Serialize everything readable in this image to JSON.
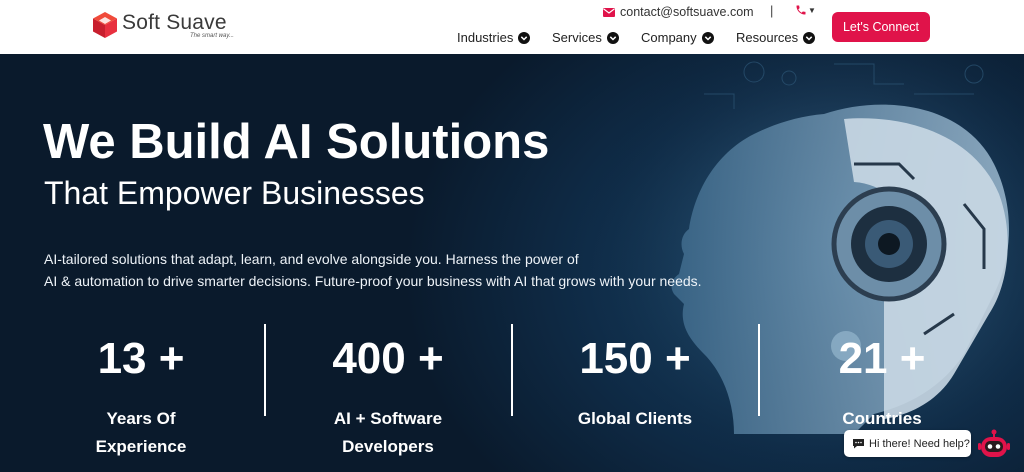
{
  "brand": {
    "name": "Soft Suave",
    "tagline": "The smart way...",
    "accent": "#e0134a"
  },
  "header": {
    "email": "contact@softsuave.com",
    "separator": "|",
    "nav": [
      {
        "label": "Industries"
      },
      {
        "label": "Services"
      },
      {
        "label": "Company"
      },
      {
        "label": "Resources"
      }
    ],
    "cta_label": "Let's Connect"
  },
  "hero": {
    "title": "We Build AI Solutions",
    "subtitle": "That Empower Businesses",
    "description_line1": "AI-tailored solutions that adapt, learn, and evolve alongside you. Harness the power of",
    "description_line2": "AI & automation to drive smarter decisions. Future-proof your business with AI that grows with your needs.",
    "stats": [
      {
        "value": "13 +",
        "label_line1": "Years Of",
        "label_line2": "Experience"
      },
      {
        "value": "400 +",
        "label_line1": "AI + Software",
        "label_line2": "Developers"
      },
      {
        "value": "150 +",
        "label_line1": "Global Clients",
        "label_line2": ""
      },
      {
        "value": "21 +",
        "label_line1": "Countries",
        "label_line2": ""
      }
    ]
  },
  "chat": {
    "text": "Hi there! Need help?"
  },
  "icons": [
    "logo-cube-icon",
    "mail-icon",
    "phone-icon",
    "chevron-down-icon",
    "chat-bubble-icon",
    "chatbot-icon"
  ]
}
